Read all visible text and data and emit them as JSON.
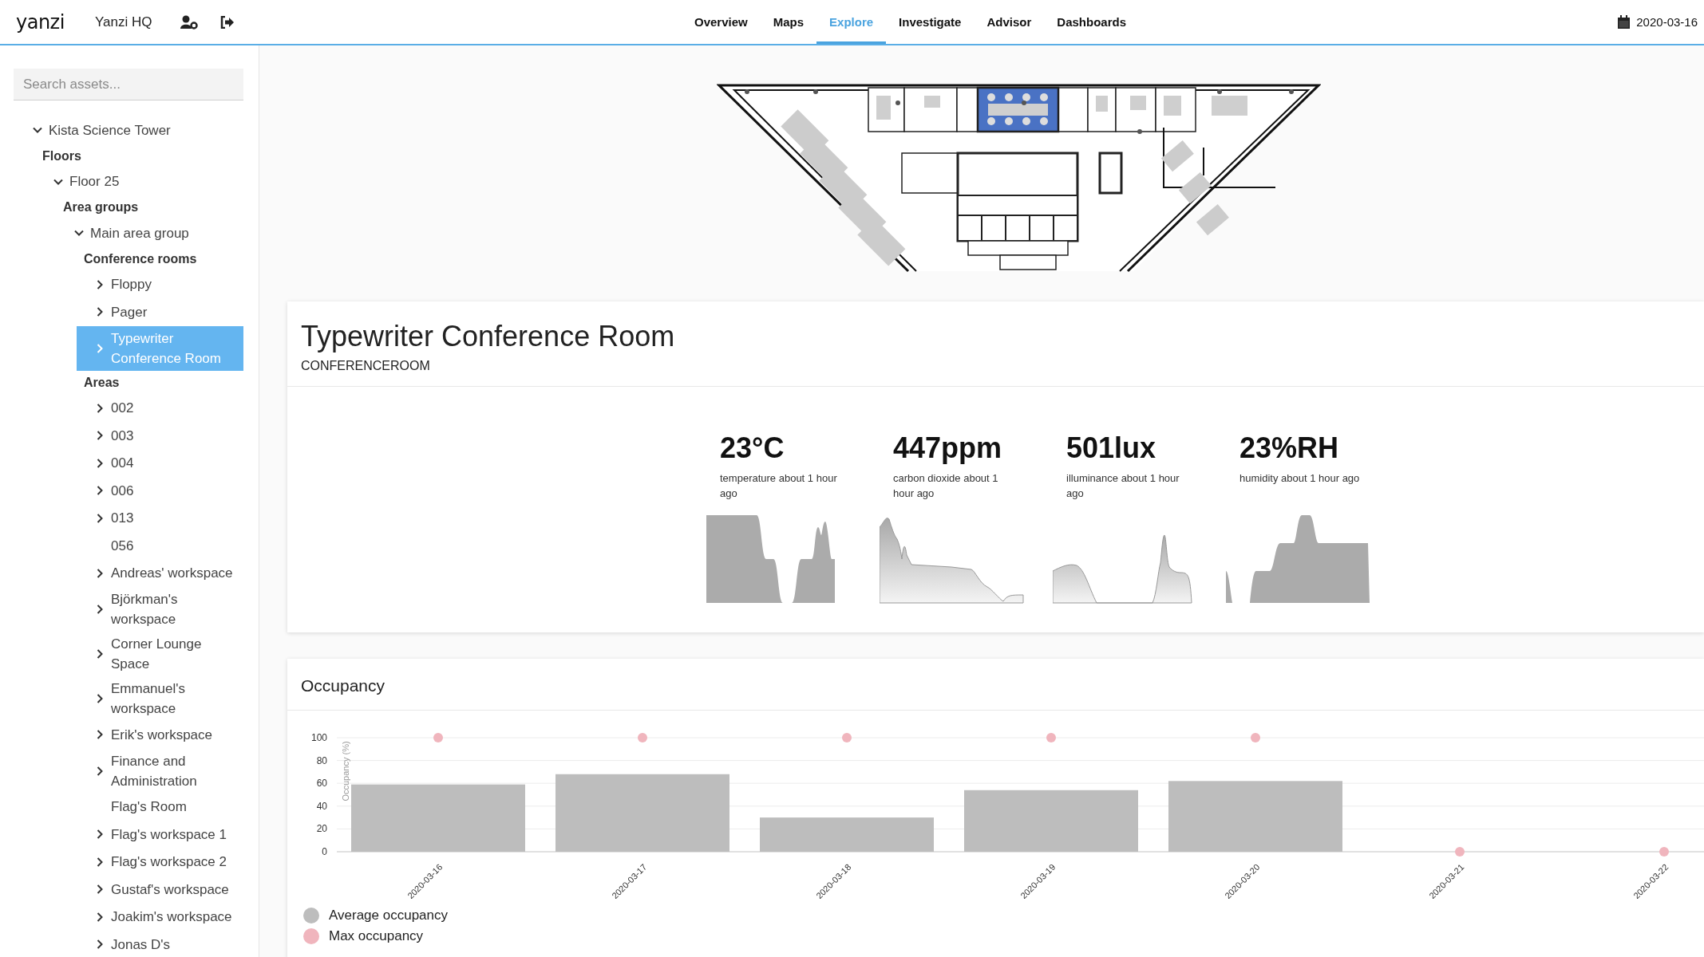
{
  "topbar": {
    "logo": "yanzi",
    "site": "Yanzi HQ",
    "nav": [
      {
        "label": "Overview",
        "selected": false
      },
      {
        "label": "Maps",
        "selected": false
      },
      {
        "label": "Explore",
        "selected": true
      },
      {
        "label": "Investigate",
        "selected": false
      },
      {
        "label": "Advisor",
        "selected": false
      },
      {
        "label": "Dashboards",
        "selected": false
      }
    ],
    "date": "2020-03-16"
  },
  "sidebar": {
    "search": {
      "placeholder": "Search assets..."
    },
    "tree": [
      {
        "kind": "node",
        "label": "Kista Science Tower",
        "expanded": true,
        "selected": false,
        "children": [
          {
            "kind": "heading",
            "label": "Floors",
            "children": [
              {
                "kind": "node",
                "label": "Floor 25",
                "expanded": true,
                "selected": false,
                "children": [
                  {
                    "kind": "heading",
                    "label": "Area groups",
                    "children": [
                      {
                        "kind": "node",
                        "label": "Main area group",
                        "expanded": true,
                        "selected": false,
                        "children": [
                          {
                            "kind": "heading",
                            "label": "Conference rooms",
                            "children": [
                              {
                                "kind": "node",
                                "label": "Floppy",
                                "expanded": false,
                                "selected": false
                              },
                              {
                                "kind": "node",
                                "label": "Pager",
                                "expanded": false,
                                "selected": false
                              },
                              {
                                "kind": "node",
                                "label": "Typewriter Conference Room",
                                "expanded": false,
                                "selected": true
                              }
                            ]
                          },
                          {
                            "kind": "heading",
                            "label": "Areas",
                            "children": [
                              {
                                "kind": "node",
                                "label": "002",
                                "expanded": false,
                                "selected": false
                              },
                              {
                                "kind": "node",
                                "label": "003",
                                "expanded": false,
                                "selected": false
                              },
                              {
                                "kind": "node",
                                "label": "004",
                                "expanded": false,
                                "selected": false
                              },
                              {
                                "kind": "node",
                                "label": "006",
                                "expanded": false,
                                "selected": false
                              },
                              {
                                "kind": "node",
                                "label": "013",
                                "expanded": false,
                                "selected": false
                              },
                              {
                                "kind": "leaf",
                                "label": "056",
                                "selected": false
                              },
                              {
                                "kind": "node",
                                "label": "Andreas' workspace",
                                "expanded": false,
                                "selected": false
                              },
                              {
                                "kind": "node",
                                "label": "Björkman's workspace",
                                "expanded": false,
                                "selected": false
                              },
                              {
                                "kind": "node",
                                "label": "Corner Lounge Space",
                                "expanded": false,
                                "selected": false
                              },
                              {
                                "kind": "node",
                                "label": "Emmanuel's workspace",
                                "expanded": false,
                                "selected": false
                              },
                              {
                                "kind": "node",
                                "label": "Erik's workspace",
                                "expanded": false,
                                "selected": false
                              },
                              {
                                "kind": "node",
                                "label": "Finance and Administration",
                                "expanded": false,
                                "selected": false
                              },
                              {
                                "kind": "leaf",
                                "label": "Flag's Room",
                                "selected": false
                              },
                              {
                                "kind": "node",
                                "label": "Flag's workspace 1",
                                "expanded": false,
                                "selected": false
                              },
                              {
                                "kind": "node",
                                "label": "Flag's workspace 2",
                                "expanded": false,
                                "selected": false
                              },
                              {
                                "kind": "node",
                                "label": "Gustaf's workspace",
                                "expanded": false,
                                "selected": false
                              },
                              {
                                "kind": "node",
                                "label": "Joakim's workspace",
                                "expanded": false,
                                "selected": false
                              },
                              {
                                "kind": "node",
                                "label": "Jonas D's",
                                "expanded": false,
                                "selected": false
                              }
                            ]
                          }
                        ]
                      }
                    ]
                  }
                ]
              }
            ]
          }
        ]
      }
    ]
  },
  "room": {
    "title": "Typewriter Conference Room",
    "type": "CONFERENCEROOM",
    "metrics": [
      {
        "value": "23°C",
        "label": "temperature about 1 hour ago"
      },
      {
        "value": "447ppm",
        "label": "carbon dioxide about 1 hour ago"
      },
      {
        "value": "501lux",
        "label": "illuminance about 1 hour ago"
      },
      {
        "value": "23%RH",
        "label": "humidity about 1 hour ago"
      }
    ]
  },
  "occupancy": {
    "title": "Occupancy",
    "chart_data": {
      "type": "bar",
      "ylabel": "Occupancy (%)",
      "grid": true,
      "categories": [
        "2020-03-16",
        "2020-03-17",
        "2020-03-18",
        "2020-03-19",
        "2020-03-20",
        "2020-03-21",
        "2020-03-22"
      ],
      "series": [
        {
          "name": "Average occupancy",
          "type": "bar",
          "color": "#bdbdbd",
          "values": [
            59,
            68,
            30,
            54,
            62,
            0,
            0
          ]
        },
        {
          "name": "Max occupancy",
          "type": "scatter",
          "color": "#f0b5bd",
          "values": [
            100,
            100,
            100,
            100,
            100,
            0,
            0
          ]
        }
      ],
      "ylim": [
        0,
        100
      ],
      "yticks": [
        0,
        20,
        40,
        60,
        80,
        100
      ]
    }
  }
}
